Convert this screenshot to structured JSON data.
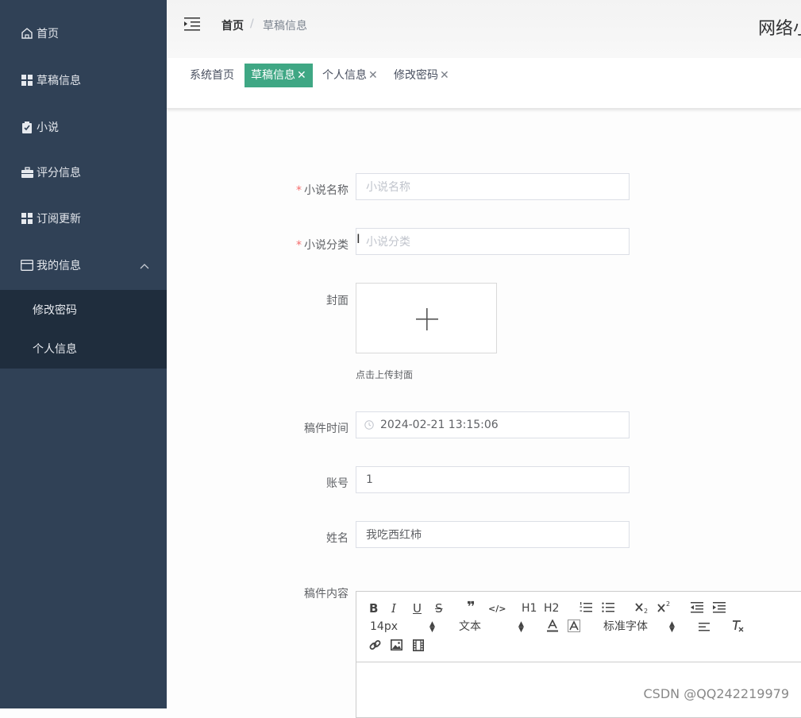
{
  "sidebar": {
    "items": [
      {
        "label": "首页",
        "icon": "home-icon"
      },
      {
        "label": "草稿信息",
        "icon": "grid-icon"
      },
      {
        "label": "小说",
        "icon": "clipboard-check-icon"
      },
      {
        "label": "评分信息",
        "icon": "briefcase-icon"
      },
      {
        "label": "订阅更新",
        "icon": "grid-icon"
      },
      {
        "label": "我的信息",
        "icon": "card-icon",
        "expanded": true
      }
    ],
    "submenu": [
      {
        "label": "修改密码"
      },
      {
        "label": "个人信息"
      }
    ],
    "colors": {
      "bg": "#304156",
      "submenu_bg": "#1f2d3d"
    }
  },
  "header": {
    "breadcrumb_home": "首页",
    "breadcrumb_sep": "/",
    "breadcrumb_current": "草稿信息",
    "site_title": "网络小"
  },
  "tags": [
    {
      "label": "系统首页",
      "closable": false,
      "active": false
    },
    {
      "label": "草稿信息",
      "closable": true,
      "active": true
    },
    {
      "label": "个人信息",
      "closable": true,
      "active": false
    },
    {
      "label": "修改密码",
      "closable": true,
      "active": false
    }
  ],
  "tag_close_glyph": "✕",
  "accent_color": "#3fa784",
  "form": {
    "required_mark": "*",
    "novel_name": {
      "label": "小说名称",
      "placeholder": "小说名称",
      "value": ""
    },
    "novel_category": {
      "label": "小说分类",
      "placeholder": "小说分类",
      "value": ""
    },
    "cover": {
      "label": "封面",
      "tip": "点击上传封面"
    },
    "draft_time": {
      "label": "稿件时间",
      "value": "2024-02-21 13:15:06"
    },
    "account": {
      "label": "账号",
      "value": "1"
    },
    "name": {
      "label": "姓名",
      "value": "我吃西红柿"
    },
    "content": {
      "label": "稿件内容"
    }
  },
  "editor": {
    "buttons_row1": [
      "B",
      "I",
      "U",
      "S",
      "❞",
      "</>",
      "H1",
      "H2",
      "ordered-list",
      "bullet-list",
      "subscript",
      "superscript",
      "outdent",
      "indent"
    ],
    "size_select": "14px",
    "text_select": "文本",
    "font_select": "标准字体"
  },
  "watermark": "CSDN @QQ242219979"
}
